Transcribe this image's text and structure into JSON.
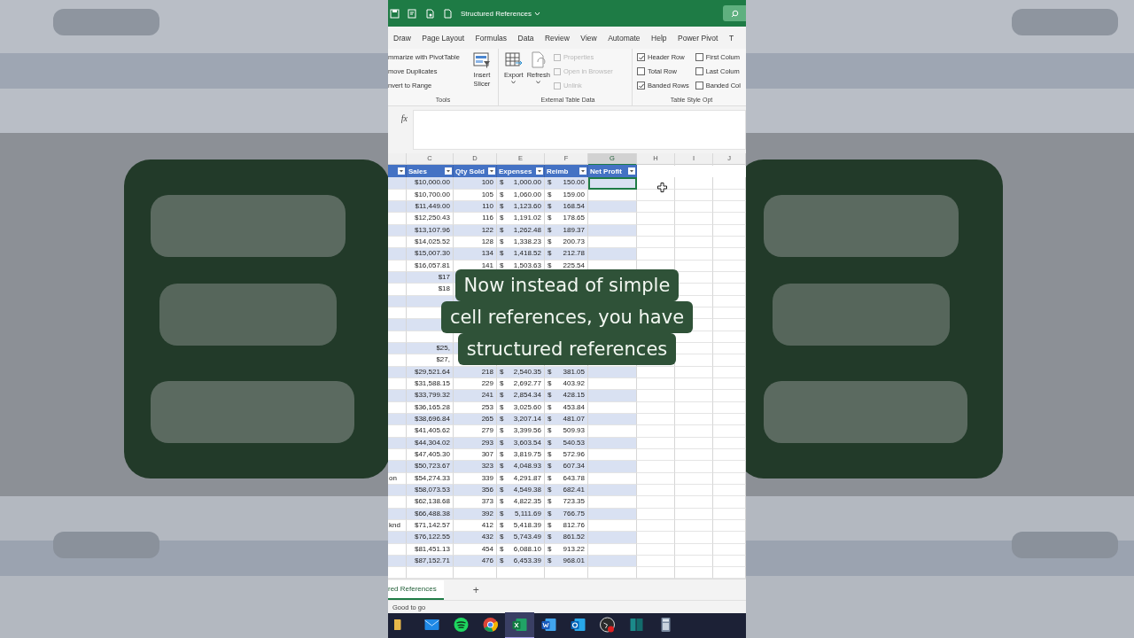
{
  "title_bar": {
    "doc_title": "Structured References"
  },
  "ribbon_tabs": [
    "Draw",
    "Page Layout",
    "Formulas",
    "Data",
    "Review",
    "View",
    "Automate",
    "Help",
    "Power Pivot",
    "T"
  ],
  "tools": {
    "items": [
      "mmarize with PivotTable",
      "move Duplicates",
      "nvert to Range"
    ],
    "slicer": "Insert Slicer",
    "label": "Tools"
  },
  "external": {
    "export": "Export",
    "refresh": "Refresh",
    "links": [
      {
        "label": "Properties",
        "disabled": true
      },
      {
        "label": "Open in Browser",
        "disabled": true
      },
      {
        "label": "Unlink",
        "disabled": true
      }
    ],
    "label": "External Table Data"
  },
  "style_options": {
    "options": [
      {
        "label": "Header Row",
        "checked": true
      },
      {
        "label": "Total Row",
        "checked": false
      },
      {
        "label": "Banded Rows",
        "checked": true
      },
      {
        "label": "First Colum",
        "checked": false
      },
      {
        "label": "Last Colum",
        "checked": false
      },
      {
        "label": "Banded Col",
        "checked": false
      }
    ],
    "label": "Table Style Opt"
  },
  "formula_bar": {
    "fx": "fx"
  },
  "columns": [
    {
      "letter": "C",
      "selected": false
    },
    {
      "letter": "D",
      "selected": false
    },
    {
      "letter": "E",
      "selected": false
    },
    {
      "letter": "F",
      "selected": false
    },
    {
      "letter": "G",
      "selected": true
    },
    {
      "letter": "H",
      "selected": false
    },
    {
      "letter": "I",
      "selected": false
    },
    {
      "letter": "J",
      "selected": false
    }
  ],
  "headers": [
    "Sales",
    "Qty Sold",
    "Expenses",
    "Reimb",
    "Net Profit"
  ],
  "rows": [
    {
      "cells": [
        "$10,000.00",
        "100",
        "$",
        "1,000.00",
        "$",
        "150.00"
      ],
      "selected": true
    },
    {
      "cells": [
        "$10,700.00",
        "105",
        "$",
        "1,060.00",
        "$",
        "159.00"
      ],
      "selected": false
    },
    {
      "cells": [
        "$11,449.00",
        "110",
        "$",
        "1,123.60",
        "$",
        "168.54"
      ],
      "selected": false
    },
    {
      "cells": [
        "$12,250.43",
        "116",
        "$",
        "1,191.02",
        "$",
        "178.65"
      ],
      "selected": false
    },
    {
      "cells": [
        "$13,107.96",
        "122",
        "$",
        "1,262.48",
        "$",
        "189.37"
      ],
      "selected": false
    },
    {
      "cells": [
        "$14,025.52",
        "128",
        "$",
        "1,338.23",
        "$",
        "200.73"
      ],
      "selected": false
    },
    {
      "cells": [
        "$15,007.30",
        "134",
        "$",
        "1,418.52",
        "$",
        "212.78"
      ],
      "selected": false
    },
    {
      "cells": [
        "$16,057.81",
        "141",
        "$",
        "1,503.63",
        "$",
        "225.54"
      ],
      "selected": false
    },
    {
      "cells": [
        "$17"
      ]
    },
    {
      "cells": [
        "$18"
      ]
    },
    {
      "cells": []
    },
    {
      "cells": []
    },
    {
      "cells": []
    },
    {
      "cells": []
    },
    {
      "cells": [
        "$25,"
      ]
    },
    {
      "cells": [
        "$27,"
      ],
      "selected": false
    },
    {
      "cells": [
        "$29,521.64",
        "218",
        "$",
        "2,540.35",
        "$",
        "381.05"
      ],
      "selected": false
    },
    {
      "cells": [
        "$31,588.15",
        "229",
        "$",
        "2,692.77",
        "$",
        "403.92"
      ],
      "selected": false
    },
    {
      "cells": [
        "$33,799.32",
        "241",
        "$",
        "2,854.34",
        "$",
        "428.15"
      ],
      "selected": false
    },
    {
      "cells": [
        "$36,165.28",
        "253",
        "$",
        "3,025.60",
        "$",
        "453.84"
      ],
      "selected": false
    },
    {
      "cells": [
        "$38,696.84",
        "265",
        "$",
        "3,207.14",
        "$",
        "481.07"
      ],
      "selected": false
    },
    {
      "cells": [
        "$41,405.62",
        "279",
        "$",
        "3,399.56",
        "$",
        "509.93"
      ],
      "selected": false
    },
    {
      "cells": [
        "$44,304.02",
        "293",
        "$",
        "3,603.54",
        "$",
        "540.53"
      ],
      "selected": false
    },
    {
      "cells": [
        "$47,405.30",
        "307",
        "$",
        "3,819.75",
        "$",
        "572.96"
      ],
      "selected": false
    },
    {
      "cells": [
        "$50,723.67",
        "323",
        "$",
        "4,048.93",
        "$",
        "607.34"
      ],
      "selected": false
    },
    {
      "b": "on",
      "cells": [
        "$54,274.33",
        "339",
        "$",
        "4,291.87",
        "$",
        "643.78"
      ],
      "selected": false
    },
    {
      "cells": [
        "$58,073.53",
        "356",
        "$",
        "4,549.38",
        "$",
        "682.41"
      ],
      "selected": false
    },
    {
      "cells": [
        "$62,138.68",
        "373",
        "$",
        "4,822.35",
        "$",
        "723.35"
      ],
      "selected": false
    },
    {
      "cells": [
        "$66,488.38",
        "392",
        "$",
        "5,111.69",
        "$",
        "766.75"
      ],
      "selected": false
    },
    {
      "b": "knd",
      "cells": [
        "$71,142.57",
        "412",
        "$",
        "5,418.39",
        "$",
        "812.76"
      ],
      "selected": false
    },
    {
      "cells": [
        "$76,122.55",
        "432",
        "$",
        "5,743.49",
        "$",
        "861.52"
      ],
      "selected": false
    },
    {
      "cells": [
        "$81,451.13",
        "454",
        "$",
        "6,088.10",
        "$",
        "913.22"
      ],
      "selected": false
    },
    {
      "cells": [
        "$87,152.71",
        "476",
        "$",
        "6,453.39",
        "$",
        "968.01"
      ],
      "selected": false
    }
  ],
  "caption_lines": [
    "Now instead of simple",
    "cell references, you have",
    "structured references"
  ],
  "sheet_tab": {
    "label": "red References",
    "selected": true
  },
  "add_sheet": "+",
  "status": "Good to go",
  "taskbar": [
    {
      "kind": "explorer",
      "selected": false
    },
    {
      "kind": "mail",
      "selected": false
    },
    {
      "kind": "spotify",
      "selected": false
    },
    {
      "kind": "chrome",
      "selected": false
    },
    {
      "kind": "excel",
      "selected": true
    },
    {
      "kind": "word",
      "selected": false
    },
    {
      "kind": "outlook",
      "selected": false
    },
    {
      "kind": "recorder",
      "selected": false
    },
    {
      "kind": "panel",
      "selected": false
    },
    {
      "kind": "calculator",
      "selected": false
    }
  ]
}
